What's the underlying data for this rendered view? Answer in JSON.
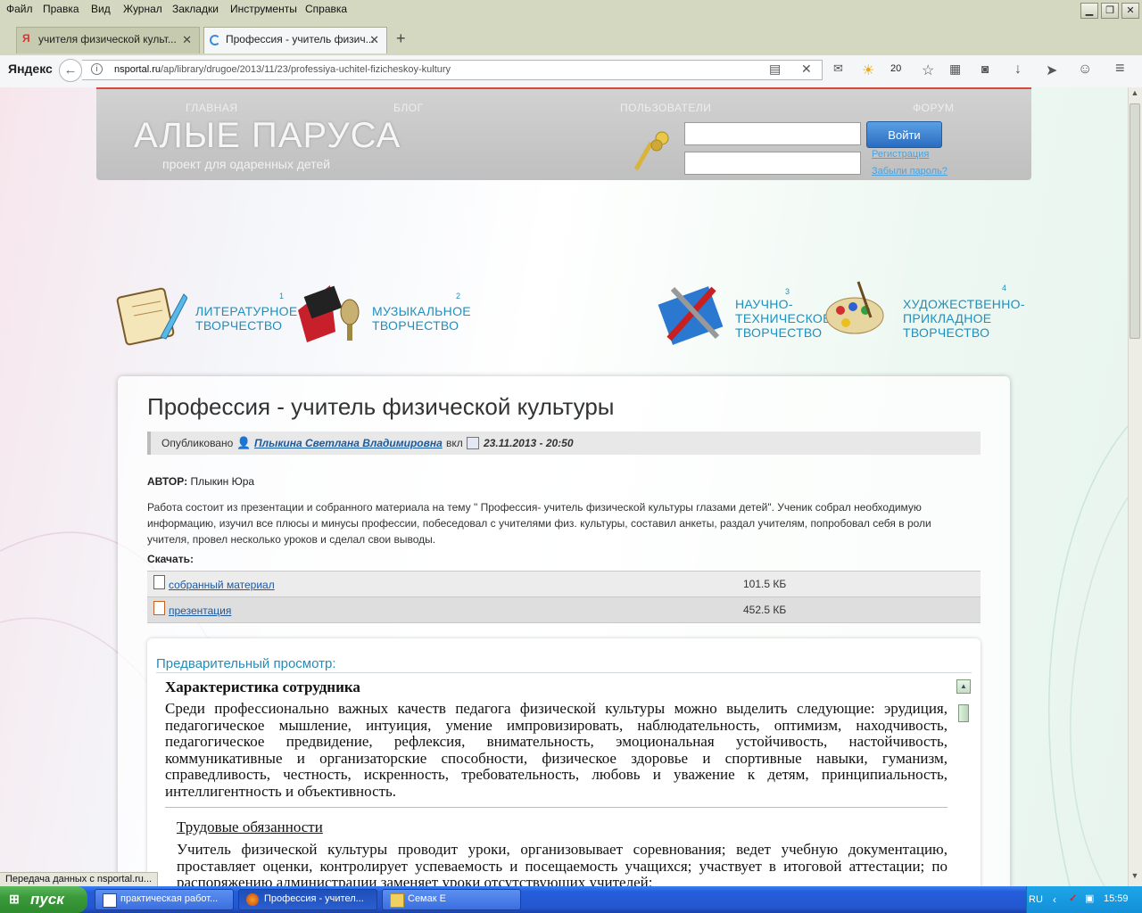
{
  "menubar": {
    "items": [
      "Файл",
      "Правка",
      "Вид",
      "Журнал",
      "Закладки",
      "Инструменты",
      "Справка"
    ]
  },
  "tabs": [
    {
      "label": "учителя физической культ...",
      "active": false
    },
    {
      "label": "Профессия - учитель физич...",
      "active": true
    }
  ],
  "navbar": {
    "brand": "Яндекс",
    "url_host": "nsportal.ru",
    "url_path": "/ap/library/drugoe/2013/11/23/professiya-uchitel-fizicheskoy-kultury",
    "weather_temp": "20"
  },
  "site": {
    "nav": [
      "ГЛАВНАЯ",
      "БЛОГ",
      "ПОЛЬЗОВАТЕЛИ",
      "ФОРУМ"
    ],
    "logo_title": "АЛЫЕ ПАРУСА",
    "logo_subtitle": "проект для одаренных детей",
    "login_button": "Войти",
    "register_link": "Регистрация",
    "forgot_link": "Забыли пароль?"
  },
  "categories": [
    {
      "num": "1",
      "line1": "ЛИТЕРАТУРНОЕ",
      "line2": "ТВОРЧЕСТВО",
      "line3": ""
    },
    {
      "num": "2",
      "line1": "МУЗЫКАЛЬНОЕ",
      "line2": "ТВОРЧЕСТВО",
      "line3": ""
    },
    {
      "num": "3",
      "line1": "НАУЧНО-",
      "line2": "ТЕХНИЧЕСКОЕ",
      "line3": "ТВОРЧЕСТВО"
    },
    {
      "num": "4",
      "line1": "ХУДОЖЕСТВЕННО-",
      "line2": "ПРИКЛАДНОЕ",
      "line3": "ТВОРЧЕСТВО"
    }
  ],
  "article": {
    "title": "Профессия - учитель физической культуры",
    "published_label": "Опубликовано",
    "author_name": "Плыкина Светлана Владимировна",
    "vkl": "вкл",
    "date": "23.11.2013 - 20:50",
    "author_label": "АВТОР:",
    "author_value": "Плыкин Юра",
    "description": "Работа состоит из презентации и собранного материала  на тему \" Профессия- учитель физической культуры глазами детей\".  Ученик собрал необходимую информацию, изучил все плюсы и минусы профессии, побеседовал с учителями физ. культуры, составил анкеты, раздал учителям, попробовал себя в роли учителя, провел несколько уроков и сделал свои выводы.",
    "download_label": "Скачать:",
    "downloads": [
      {
        "name": "собранный материал",
        "size": "101.5 КБ"
      },
      {
        "name": "презентация",
        "size": "452.5 КБ"
      }
    ]
  },
  "preview": {
    "label": "Предварительный просмотр:",
    "heading": "Характеристика сотрудника",
    "para1": "Среди профессионально важных качеств педагога физической культуры можно выделить следующие: эрудиция, педагогическое мышление, интуиция, умение импровизировать, наблюдательность, оптимизм, находчивость, педагогическое предвидение, рефлексия, внимательность, эмоциональная устойчивость, настойчивость, коммуникативные и организаторские способности, физическое здоровье и спортивные навыки, гуманизм, справедливость, честность, искренность, требовательность, любовь и уважение к детям, принципиальность, интеллигентность и объективность.",
    "subheading": "Трудовые обязанности",
    "para2": "Учитель физической культуры проводит уроки, организовывает соревнования; ведет учебную документацию, проставляет оценки, контролирует успеваемость и посещаемость учащихся; участвует в итоговой аттестации; по распоряжению администрации заменяет уроки отсутствующих учителей;"
  },
  "status": "Передача данных с nsportal.ru...",
  "taskbar": {
    "start": "пуск",
    "buttons": [
      {
        "label": "практическая работ..."
      },
      {
        "label": "Профессия - учител..."
      },
      {
        "label": "Семак Е"
      }
    ],
    "lang": "RU",
    "clock": "15:59"
  },
  "colors": {
    "accent_blue": "#1e8fbf",
    "link": "#1a5aa0",
    "taskbar": "#245edb",
    "start_green": "#3a9a3a"
  }
}
